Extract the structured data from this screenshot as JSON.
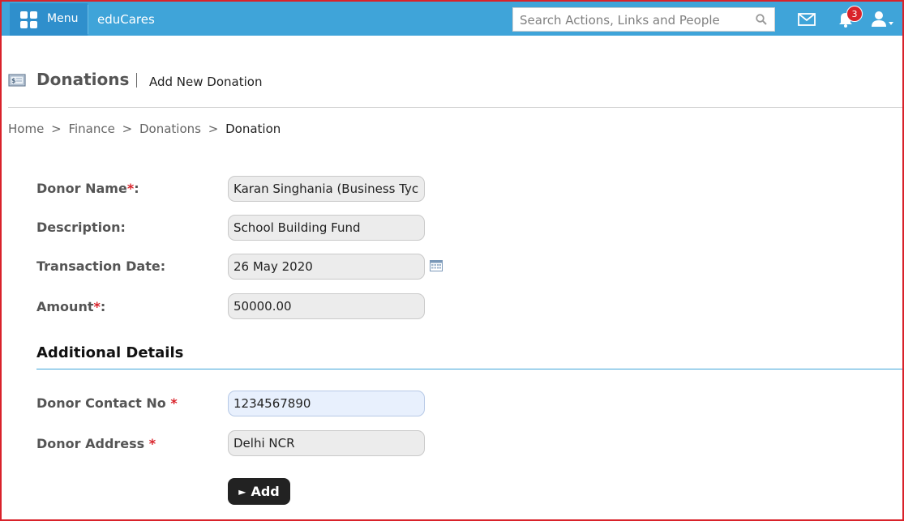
{
  "topbar": {
    "menu_label": "Menu",
    "app_name": "eduCares",
    "search_placeholder": "Search Actions, Links and People",
    "notification_count": "3",
    "accent_color": "#3fa4d9"
  },
  "page": {
    "title": "Donations",
    "subtitle": "Add New Donation"
  },
  "breadcrumb": [
    "Home",
    "Finance",
    "Donations",
    "Donation"
  ],
  "breadcrumb_separator": ">",
  "form": {
    "donor_name": {
      "label": "Donor Name",
      "required": "*",
      "suffix": ":",
      "value": "Karan Singhania (Business Tycoon)"
    },
    "description": {
      "label": "Description:",
      "value": "School Building Fund"
    },
    "transaction_date": {
      "label": "Transaction Date:",
      "value": "26 May 2020"
    },
    "amount": {
      "label": "Amount",
      "required": "*",
      "suffix": ":",
      "value": "50000.00"
    }
  },
  "additional": {
    "title": "Additional Details",
    "contact_no": {
      "label": "Donor Contact No ",
      "required": "*",
      "value": "1234567890"
    },
    "address": {
      "label": "Donor Address ",
      "required": "*",
      "value": "Delhi NCR"
    }
  },
  "actions": {
    "add_arrow": "►",
    "add_label": "Add"
  },
  "icons": [
    "grid-icon",
    "search-icon",
    "mail-icon",
    "bell-icon",
    "user-icon",
    "donation-icon",
    "calendar-icon"
  ]
}
